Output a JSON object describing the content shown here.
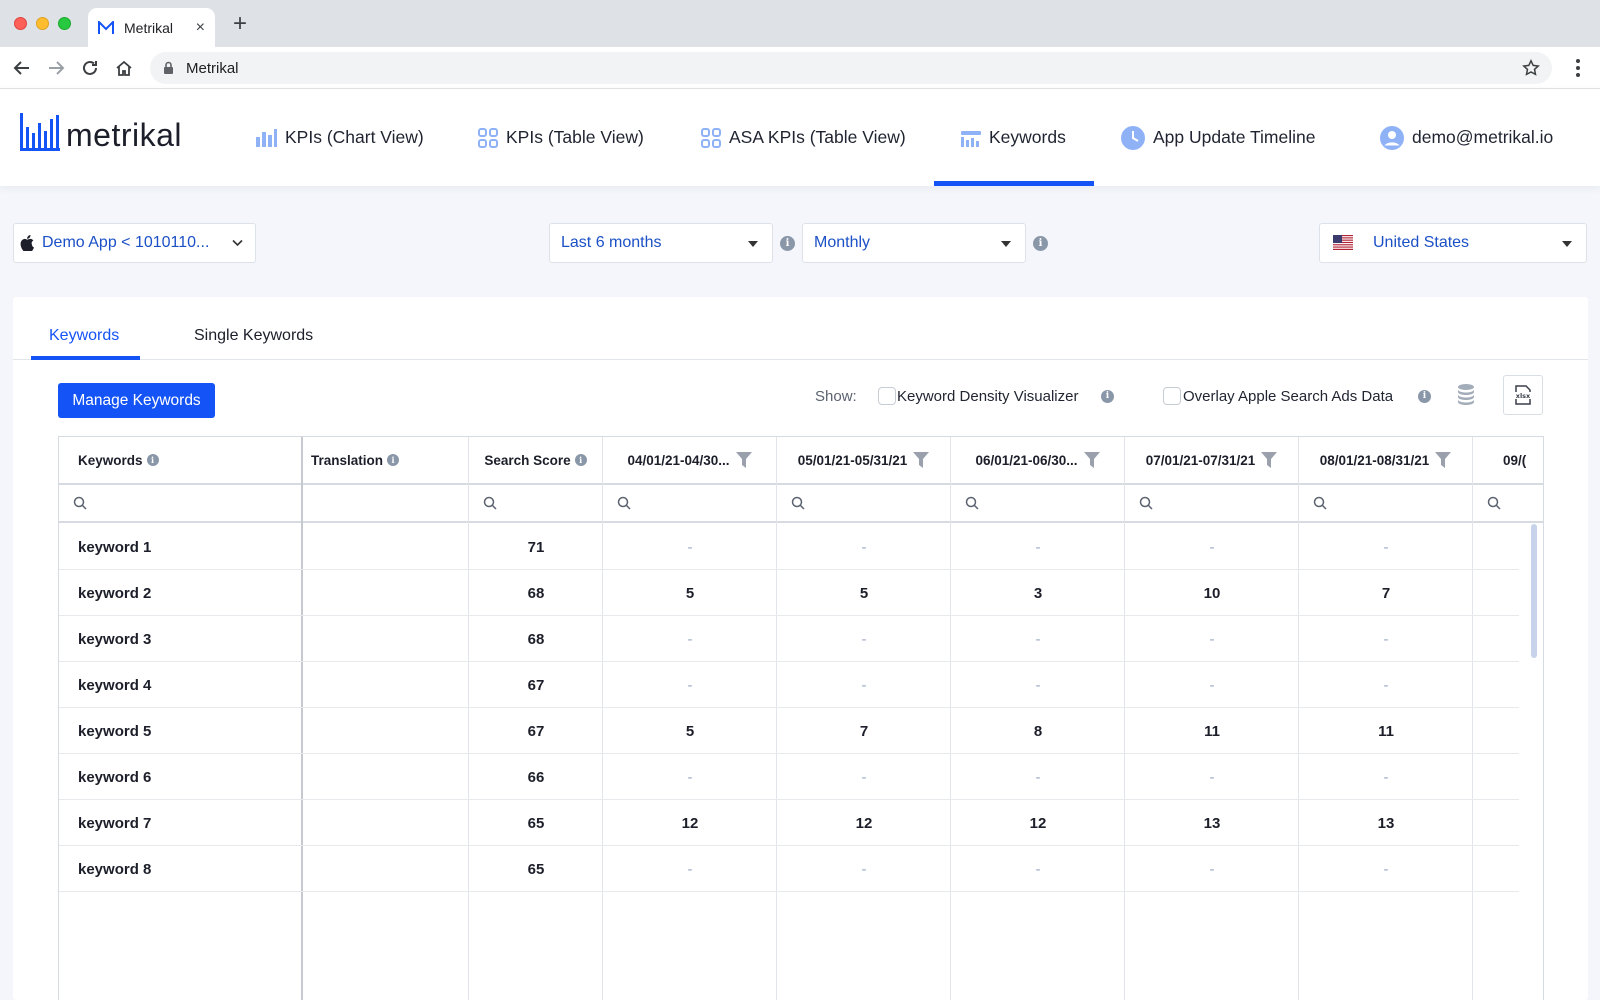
{
  "browser": {
    "tab_title": "Metrikal",
    "tab_close": "×",
    "new_tab": "+",
    "address": "Metrikal"
  },
  "app": {
    "logo_text": "metrikal",
    "brand_color": "#1453f5",
    "nav": [
      {
        "label": "KPIs (Chart View)",
        "icon": "bar-chart-icon"
      },
      {
        "label": "KPIs (Table View)",
        "icon": "grid-icon"
      },
      {
        "label": "ASA KPIs (Table View)",
        "icon": "grid-icon"
      },
      {
        "label": "Keywords",
        "icon": "keywords-icon",
        "active": true
      },
      {
        "label": "App Update Timeline",
        "icon": "clock-icon"
      },
      {
        "label": "demo@metrikal.io",
        "icon": "user-icon"
      }
    ]
  },
  "filters": {
    "app": "Demo App < 1010110...",
    "period": "Last 6 months",
    "granularity": "Monthly",
    "country": "United States"
  },
  "tabs": [
    {
      "label": "Keywords",
      "active": true
    },
    {
      "label": "Single Keywords",
      "active": false
    }
  ],
  "toolbar": {
    "manage_label": "Manage Keywords",
    "show_label": "Show:",
    "density_label": "Keyword Density Visualizer",
    "density_checked": false,
    "overlay_label": "Overlay Apple Search Ads Data",
    "overlay_checked": false
  },
  "table": {
    "columns": [
      "Keywords",
      "Translation",
      "Search Score",
      "04/01/21-04/30...",
      "05/01/21-05/31/21",
      "06/01/21-06/30...",
      "07/01/21-07/31/21",
      "08/01/21-08/31/21",
      "09/("
    ],
    "rows": [
      {
        "keyword": "keyword 1",
        "translation": "",
        "score": "71",
        "months": [
          "-",
          "-",
          "-",
          "-",
          "-"
        ]
      },
      {
        "keyword": "keyword 2",
        "translation": "",
        "score": "68",
        "months": [
          "5",
          "5",
          "3",
          "10",
          "7"
        ]
      },
      {
        "keyword": "keyword 3",
        "translation": "",
        "score": "68",
        "months": [
          "-",
          "-",
          "-",
          "-",
          "-"
        ]
      },
      {
        "keyword": "keyword 4",
        "translation": "",
        "score": "67",
        "months": [
          "-",
          "-",
          "-",
          "-",
          "-"
        ]
      },
      {
        "keyword": "keyword 5",
        "translation": "",
        "score": "67",
        "months": [
          "5",
          "7",
          "8",
          "11",
          "11"
        ]
      },
      {
        "keyword": "keyword 6",
        "translation": "",
        "score": "66",
        "months": [
          "-",
          "-",
          "-",
          "-",
          "-"
        ]
      },
      {
        "keyword": "keyword 7",
        "translation": "",
        "score": "65",
        "months": [
          "12",
          "12",
          "12",
          "13",
          "13"
        ]
      },
      {
        "keyword": "keyword 8",
        "translation": "",
        "score": "65",
        "months": [
          "-",
          "-",
          "-",
          "-",
          "-"
        ]
      }
    ]
  }
}
